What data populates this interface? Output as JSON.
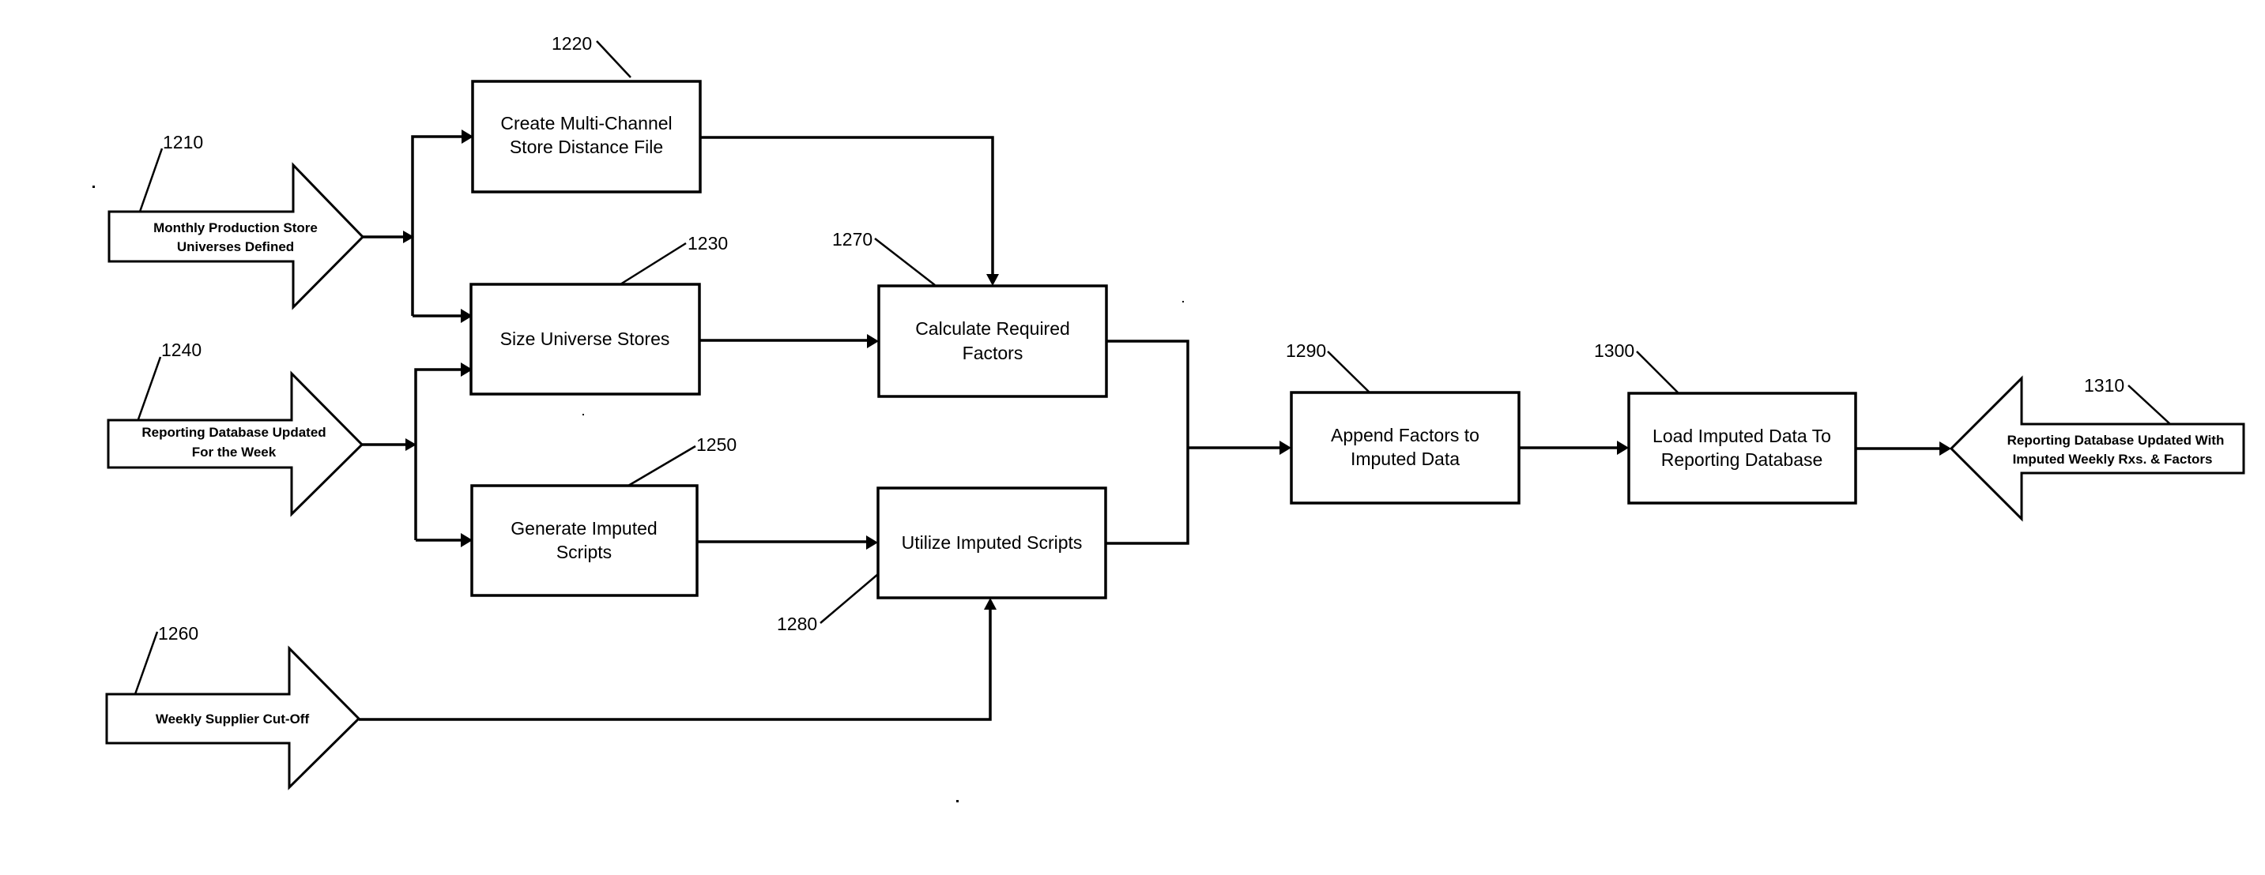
{
  "figure": {
    "description": "Flow diagram of weekly imputation process",
    "inputs": [
      {
        "ref": "1210",
        "lines": [
          "Monthly Production Store",
          "Universes Defined"
        ]
      },
      {
        "ref": "1240",
        "lines": [
          "Reporting Database Updated",
          "For the Week"
        ]
      },
      {
        "ref": "1260",
        "lines": [
          "Weekly Supplier Cut-Off"
        ]
      }
    ],
    "steps": [
      {
        "ref": "1220",
        "lines": [
          "Create Multi-Channel",
          "Store Distance File"
        ]
      },
      {
        "ref": "1230",
        "lines": [
          "Size Universe Stores"
        ]
      },
      {
        "ref": "1250",
        "lines": [
          "Generate Imputed",
          "Scripts"
        ]
      },
      {
        "ref": "1270",
        "lines": [
          "Calculate Required",
          "Factors"
        ]
      },
      {
        "ref": "1280",
        "lines": [
          "Utilize Imputed Scripts"
        ]
      },
      {
        "ref": "1290",
        "lines": [
          "Append Factors to",
          "Imputed Data"
        ]
      },
      {
        "ref": "1300",
        "lines": [
          "Load Imputed Data To",
          "Reporting Database"
        ]
      }
    ],
    "output": {
      "ref": "1310",
      "lines": [
        "Reporting Database Updated With",
        "Imputed Weekly Rxs. & Factors"
      ]
    },
    "connections": [
      {
        "from": "1210",
        "to": "1220"
      },
      {
        "from": "1210",
        "to": "1230"
      },
      {
        "from": "1240",
        "to": "1230"
      },
      {
        "from": "1240",
        "to": "1250"
      },
      {
        "from": "1220",
        "to": "1270"
      },
      {
        "from": "1230",
        "to": "1270"
      },
      {
        "from": "1250",
        "to": "1280"
      },
      {
        "from": "1260",
        "to": "1280"
      },
      {
        "from": "1270",
        "to": "1290"
      },
      {
        "from": "1280",
        "to": "1290"
      },
      {
        "from": "1290",
        "to": "1300"
      },
      {
        "from": "1300",
        "to": "1310"
      }
    ]
  }
}
